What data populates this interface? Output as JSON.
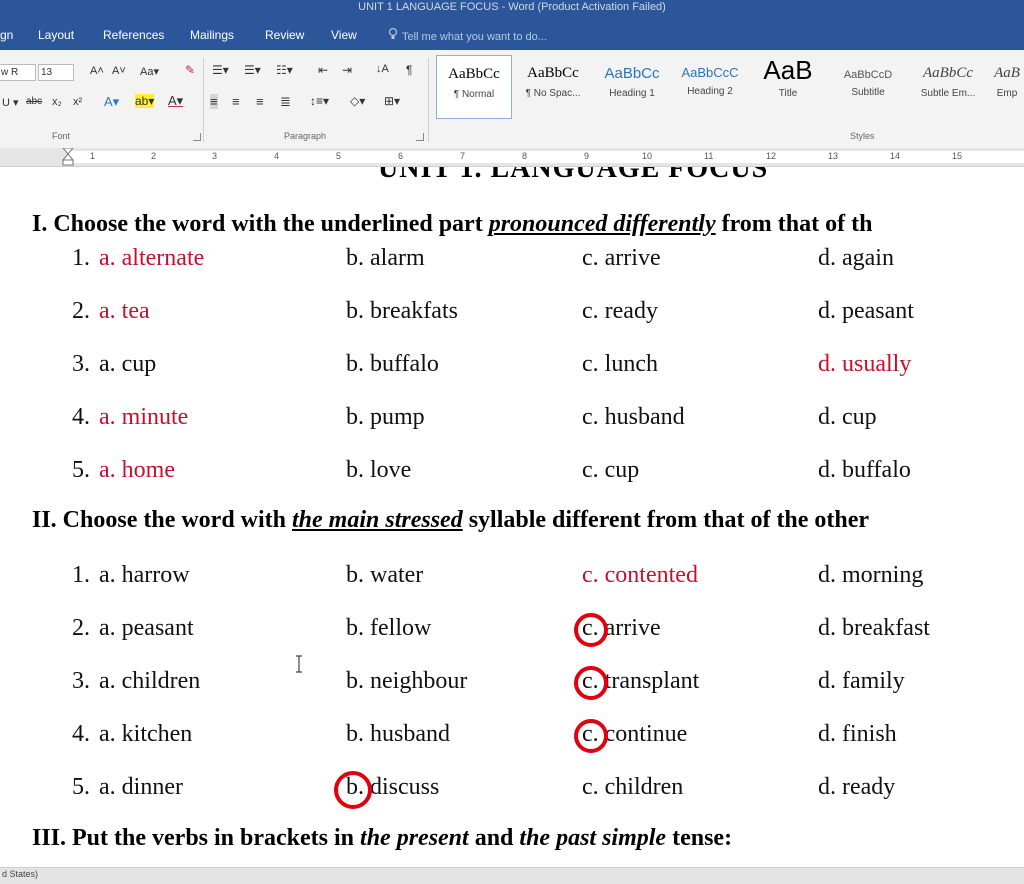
{
  "window": {
    "title": "UNIT 1 LANGUAGE FOCUS - Word (Product Activation Failed)"
  },
  "ribbon_tabs": [
    "gn",
    "Layout",
    "References",
    "Mailings",
    "Review",
    "View"
  ],
  "tell_me": "Tell me what you want to do...",
  "font": {
    "name": "w R",
    "size": "13",
    "group_label": "Font"
  },
  "paragraph": {
    "group_label": "Paragraph"
  },
  "styles": {
    "group_label": "Styles",
    "items": [
      {
        "preview": "AaBbCc",
        "name": "¶ Normal"
      },
      {
        "preview": "AaBbCc",
        "name": "¶ No Spac..."
      },
      {
        "preview": "AaBbCc",
        "name": "Heading 1"
      },
      {
        "preview": "AaBbCcC",
        "name": "Heading 2"
      },
      {
        "preview": "AaB",
        "name": "Title"
      },
      {
        "preview": "AaBbCcD",
        "name": "Subtitle"
      },
      {
        "preview": "AaBbCc",
        "name": "Subtle Em..."
      },
      {
        "preview": "AaB",
        "name": "Emp"
      }
    ]
  },
  "ruler": {
    "numbers": [
      "1",
      "2",
      "3",
      "4",
      "5",
      "6",
      "7",
      "8",
      "9",
      "10",
      "11",
      "12",
      "13",
      "14",
      "15"
    ]
  },
  "document": {
    "heading_partial": "UNIT 1. LANGUAGE FOCUS",
    "section1": {
      "pre": "I. Choose the word with the underlined part ",
      "emph": "pronounced differently",
      "post": " from that of th"
    },
    "section1_rows": [
      {
        "n": "1.",
        "a": "a. alternate",
        "b": "b. alarm",
        "c": "c. arrive",
        "d": "d. again"
      },
      {
        "n": "2.",
        "a": "a. tea",
        "b": "b. breakfats",
        "c": "c. ready",
        "d": "d. peasant"
      },
      {
        "n": "3.",
        "a": "a. cup",
        "b": "b. buffalo",
        "c": "c. lunch",
        "d": "d. usually"
      },
      {
        "n": "4.",
        "a": "a. minute",
        "b": "b. pump",
        "c": "c. husband",
        "d": "d. cup"
      },
      {
        "n": "5.",
        "a": "a. home",
        "b": "b. love",
        "c": "c. cup",
        "d": "d. buffalo"
      }
    ],
    "section2": {
      "pre": "II. Choose the word with ",
      "emph": "the main stressed",
      "post": " syllable different from that of the other"
    },
    "section2_rows": [
      {
        "n": "1.",
        "a": "a. harrow",
        "b": "b. water",
        "c": "c. contented",
        "d": "d. morning"
      },
      {
        "n": "2.",
        "a": "a. peasant",
        "b": "b. fellow",
        "c": "c. arrive",
        "d": "d. breakfast"
      },
      {
        "n": "3.",
        "a": "a. children",
        "b": "b. neighbour",
        "c": "c. transplant",
        "d": "d. family"
      },
      {
        "n": "4.",
        "a": "a. kitchen",
        "b": "b. husband",
        "c": "c. continue",
        "d": "d. finish"
      },
      {
        "n": "5.",
        "a": "a. dinner",
        "b": "b. discuss",
        "c": "c. children",
        "d": "d. ready"
      }
    ],
    "section3": {
      "pre": "III. Put the verbs in brackets in ",
      "emph1": "the present",
      "mid": " and ",
      "emph2": "the past simple",
      "post": " tense:"
    }
  },
  "status_bar": {
    "language": "d States)"
  },
  "colors": {
    "ribbon_blue": "#2b579a",
    "answer_red": "#c8102e",
    "circle_red": "#e0000f"
  }
}
